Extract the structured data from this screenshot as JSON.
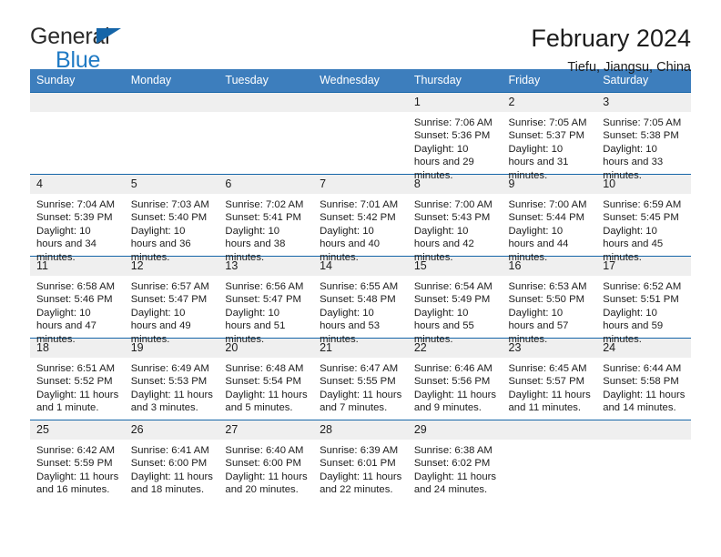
{
  "brand": {
    "line1": "General",
    "line2": "Blue",
    "triangle_icon": "blue-triangle-logo-mark",
    "color_dark": "#2b2b2b",
    "color_blue": "#1f7ac4"
  },
  "header": {
    "title": "February 2024",
    "subtitle": "Tiefu, Jiangsu, China"
  },
  "theme": {
    "header_blue": "#3d7ebd",
    "row_rule_blue": "#1565a8",
    "daynum_band": "#efefef"
  },
  "weekday_headers": [
    "Sunday",
    "Monday",
    "Tuesday",
    "Wednesday",
    "Thursday",
    "Friday",
    "Saturday"
  ],
  "weeks": [
    [
      {
        "day": "",
        "sunrise": "",
        "sunset": "",
        "daylight": ""
      },
      {
        "day": "",
        "sunrise": "",
        "sunset": "",
        "daylight": ""
      },
      {
        "day": "",
        "sunrise": "",
        "sunset": "",
        "daylight": ""
      },
      {
        "day": "",
        "sunrise": "",
        "sunset": "",
        "daylight": ""
      },
      {
        "day": "1",
        "sunrise": "Sunrise: 7:06 AM",
        "sunset": "Sunset: 5:36 PM",
        "daylight": "Daylight: 10 hours and 29 minutes."
      },
      {
        "day": "2",
        "sunrise": "Sunrise: 7:05 AM",
        "sunset": "Sunset: 5:37 PM",
        "daylight": "Daylight: 10 hours and 31 minutes."
      },
      {
        "day": "3",
        "sunrise": "Sunrise: 7:05 AM",
        "sunset": "Sunset: 5:38 PM",
        "daylight": "Daylight: 10 hours and 33 minutes."
      }
    ],
    [
      {
        "day": "4",
        "sunrise": "Sunrise: 7:04 AM",
        "sunset": "Sunset: 5:39 PM",
        "daylight": "Daylight: 10 hours and 34 minutes."
      },
      {
        "day": "5",
        "sunrise": "Sunrise: 7:03 AM",
        "sunset": "Sunset: 5:40 PM",
        "daylight": "Daylight: 10 hours and 36 minutes."
      },
      {
        "day": "6",
        "sunrise": "Sunrise: 7:02 AM",
        "sunset": "Sunset: 5:41 PM",
        "daylight": "Daylight: 10 hours and 38 minutes."
      },
      {
        "day": "7",
        "sunrise": "Sunrise: 7:01 AM",
        "sunset": "Sunset: 5:42 PM",
        "daylight": "Daylight: 10 hours and 40 minutes."
      },
      {
        "day": "8",
        "sunrise": "Sunrise: 7:00 AM",
        "sunset": "Sunset: 5:43 PM",
        "daylight": "Daylight: 10 hours and 42 minutes."
      },
      {
        "day": "9",
        "sunrise": "Sunrise: 7:00 AM",
        "sunset": "Sunset: 5:44 PM",
        "daylight": "Daylight: 10 hours and 44 minutes."
      },
      {
        "day": "10",
        "sunrise": "Sunrise: 6:59 AM",
        "sunset": "Sunset: 5:45 PM",
        "daylight": "Daylight: 10 hours and 45 minutes."
      }
    ],
    [
      {
        "day": "11",
        "sunrise": "Sunrise: 6:58 AM",
        "sunset": "Sunset: 5:46 PM",
        "daylight": "Daylight: 10 hours and 47 minutes."
      },
      {
        "day": "12",
        "sunrise": "Sunrise: 6:57 AM",
        "sunset": "Sunset: 5:47 PM",
        "daylight": "Daylight: 10 hours and 49 minutes."
      },
      {
        "day": "13",
        "sunrise": "Sunrise: 6:56 AM",
        "sunset": "Sunset: 5:47 PM",
        "daylight": "Daylight: 10 hours and 51 minutes."
      },
      {
        "day": "14",
        "sunrise": "Sunrise: 6:55 AM",
        "sunset": "Sunset: 5:48 PM",
        "daylight": "Daylight: 10 hours and 53 minutes."
      },
      {
        "day": "15",
        "sunrise": "Sunrise: 6:54 AM",
        "sunset": "Sunset: 5:49 PM",
        "daylight": "Daylight: 10 hours and 55 minutes."
      },
      {
        "day": "16",
        "sunrise": "Sunrise: 6:53 AM",
        "sunset": "Sunset: 5:50 PM",
        "daylight": "Daylight: 10 hours and 57 minutes."
      },
      {
        "day": "17",
        "sunrise": "Sunrise: 6:52 AM",
        "sunset": "Sunset: 5:51 PM",
        "daylight": "Daylight: 10 hours and 59 minutes."
      }
    ],
    [
      {
        "day": "18",
        "sunrise": "Sunrise: 6:51 AM",
        "sunset": "Sunset: 5:52 PM",
        "daylight": "Daylight: 11 hours and 1 minute."
      },
      {
        "day": "19",
        "sunrise": "Sunrise: 6:49 AM",
        "sunset": "Sunset: 5:53 PM",
        "daylight": "Daylight: 11 hours and 3 minutes."
      },
      {
        "day": "20",
        "sunrise": "Sunrise: 6:48 AM",
        "sunset": "Sunset: 5:54 PM",
        "daylight": "Daylight: 11 hours and 5 minutes."
      },
      {
        "day": "21",
        "sunrise": "Sunrise: 6:47 AM",
        "sunset": "Sunset: 5:55 PM",
        "daylight": "Daylight: 11 hours and 7 minutes."
      },
      {
        "day": "22",
        "sunrise": "Sunrise: 6:46 AM",
        "sunset": "Sunset: 5:56 PM",
        "daylight": "Daylight: 11 hours and 9 minutes."
      },
      {
        "day": "23",
        "sunrise": "Sunrise: 6:45 AM",
        "sunset": "Sunset: 5:57 PM",
        "daylight": "Daylight: 11 hours and 11 minutes."
      },
      {
        "day": "24",
        "sunrise": "Sunrise: 6:44 AM",
        "sunset": "Sunset: 5:58 PM",
        "daylight": "Daylight: 11 hours and 14 minutes."
      }
    ],
    [
      {
        "day": "25",
        "sunrise": "Sunrise: 6:42 AM",
        "sunset": "Sunset: 5:59 PM",
        "daylight": "Daylight: 11 hours and 16 minutes."
      },
      {
        "day": "26",
        "sunrise": "Sunrise: 6:41 AM",
        "sunset": "Sunset: 6:00 PM",
        "daylight": "Daylight: 11 hours and 18 minutes."
      },
      {
        "day": "27",
        "sunrise": "Sunrise: 6:40 AM",
        "sunset": "Sunset: 6:00 PM",
        "daylight": "Daylight: 11 hours and 20 minutes."
      },
      {
        "day": "28",
        "sunrise": "Sunrise: 6:39 AM",
        "sunset": "Sunset: 6:01 PM",
        "daylight": "Daylight: 11 hours and 22 minutes."
      },
      {
        "day": "29",
        "sunrise": "Sunrise: 6:38 AM",
        "sunset": "Sunset: 6:02 PM",
        "daylight": "Daylight: 11 hours and 24 minutes."
      },
      {
        "day": "",
        "sunrise": "",
        "sunset": "",
        "daylight": ""
      },
      {
        "day": "",
        "sunrise": "",
        "sunset": "",
        "daylight": ""
      }
    ]
  ]
}
